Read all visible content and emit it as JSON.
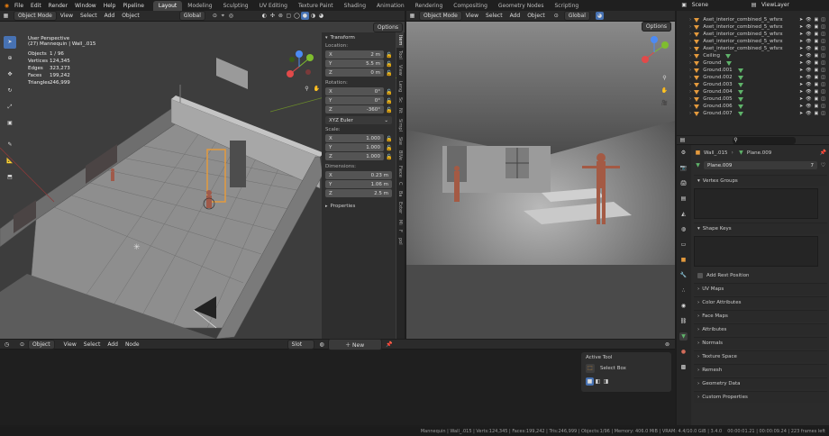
{
  "topbar": {
    "menus": [
      "File",
      "Edit",
      "Render",
      "Window",
      "Help",
      "Pipeline"
    ],
    "workspace_tabs": [
      "Layout",
      "Modeling",
      "Sculpting",
      "UV Editing",
      "Texture Paint",
      "Shading",
      "Animation",
      "Rendering",
      "Compositing",
      "Geometry Nodes",
      "Scripting"
    ],
    "active_tab": "Layout",
    "scene": "Scene",
    "view_layer": "ViewLayer"
  },
  "viewport_left": {
    "mode": "Object Mode",
    "menus": [
      "View",
      "Select",
      "Add",
      "Object"
    ],
    "transform_orientation": "Global",
    "options": "Options",
    "info_title": "User Perspective",
    "info_sub": "(27) Mannequin | Wall_.015",
    "stats": [
      {
        "k": "Objects",
        "v": "1 / 96"
      },
      {
        "k": "Vertices",
        "v": "124,345"
      },
      {
        "k": "Edges",
        "v": "323,273"
      },
      {
        "k": "Faces",
        "v": "199,242"
      },
      {
        "k": "Triangles",
        "v": "246,999"
      }
    ]
  },
  "n_panel": {
    "title": "Transform",
    "location_label": "Location:",
    "location": [
      {
        "a": "X",
        "v": "2 m"
      },
      {
        "a": "Y",
        "v": "5.5 m"
      },
      {
        "a": "Z",
        "v": "0 m"
      }
    ],
    "rotation_label": "Rotation:",
    "rotation": [
      {
        "a": "X",
        "v": "0°"
      },
      {
        "a": "Y",
        "v": "0°"
      },
      {
        "a": "Z",
        "v": "-360°"
      }
    ],
    "rotation_mode": "XYZ Euler",
    "scale_label": "Scale:",
    "scale": [
      {
        "a": "X",
        "v": "1.000"
      },
      {
        "a": "Y",
        "v": "1.000"
      },
      {
        "a": "Z",
        "v": "1.000"
      }
    ],
    "dimensions_label": "Dimensions:",
    "dimensions": [
      {
        "a": "X",
        "v": "0.23 m"
      },
      {
        "a": "Y",
        "v": "1.06 m"
      },
      {
        "a": "Z",
        "v": "2.5 m"
      }
    ],
    "properties": "Properties",
    "side_tabs": [
      "Item",
      "Tool",
      "View",
      "Leng",
      "Sc",
      "Nt",
      "Simpl",
      "Ske",
      "BlVe",
      "Fiece",
      "C",
      "Ba",
      "Exter",
      "Mi",
      "F",
      "pol"
    ]
  },
  "viewport_right": {
    "mode": "Object Mode",
    "menus": [
      "View",
      "Select",
      "Add",
      "Object"
    ],
    "transform_orientation": "Global",
    "options": "Options"
  },
  "outliner": {
    "items": [
      {
        "name": "Aset_interior_combined_5_wfsrx",
        "mesh": false
      },
      {
        "name": "Aset_interior_combined_5_wfsrx",
        "mesh": false
      },
      {
        "name": "Aset_interior_combined_5_wfsrx",
        "mesh": false
      },
      {
        "name": "Aset_interior_combined_5_wfsrx",
        "mesh": false
      },
      {
        "name": "Aset_interior_combined_5_wfsrx",
        "mesh": false
      },
      {
        "name": "Ceiling",
        "mesh": true
      },
      {
        "name": "Ground",
        "mesh": true
      },
      {
        "name": "Ground.001",
        "mesh": true
      },
      {
        "name": "Ground.002",
        "mesh": true
      },
      {
        "name": "Ground.003",
        "mesh": true
      },
      {
        "name": "Ground.004",
        "mesh": true
      },
      {
        "name": "Ground.005",
        "mesh": true
      },
      {
        "name": "Ground.006",
        "mesh": true
      },
      {
        "name": "Ground.007",
        "mesh": true
      }
    ]
  },
  "properties": {
    "object": "Wall_.015",
    "data": "Plane.009",
    "mesh_name": "Plane.009",
    "users": "7",
    "sections": [
      "Vertex Groups",
      "Shape Keys"
    ],
    "add_rest_position": "Add Rest Position",
    "collapsed": [
      "UV Maps",
      "Color Attributes",
      "Face Maps",
      "Attributes",
      "Normals",
      "Texture Space",
      "Remesh",
      "Geometry Data",
      "Custom Properties"
    ]
  },
  "timeline": {
    "editor": "Object",
    "menus": [
      "View",
      "Select",
      "Add",
      "Node"
    ],
    "slot": "Slot",
    "new": "New"
  },
  "active_tool": {
    "title": "Active Tool",
    "tool": "Select Box"
  },
  "statusbar": {
    "text": "Mannequin | Wall_.015 | Verts:124,345 | Faces:199,242 | Tris:246,999 | Objects:1/96 | Memory: 406.0 MiB | VRAM: 4.4/10.0 GiB | 3.4.0",
    "clock": "00:00:01.21 | 00:00:09.24 | 223 frames left"
  },
  "colors": {
    "accent": "#4772b3",
    "select": "#e49a3d",
    "mesh": "#5fb36a"
  },
  "icons": [
    "cursor-icon",
    "move-icon",
    "rotate-icon",
    "scale-icon",
    "transform-icon",
    "annotate-icon",
    "measure-icon",
    "add-cube-icon",
    "hand-icon",
    "zoom-icon",
    "camera-icon",
    "eye-icon",
    "filter-icon",
    "search-icon",
    "pin-icon",
    "wrench-icon",
    "material-icon"
  ]
}
